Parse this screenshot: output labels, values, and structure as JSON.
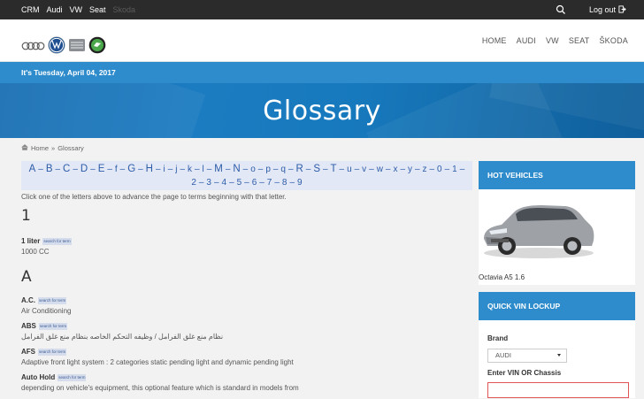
{
  "topbar": {
    "links": [
      "CRM",
      "Audi",
      "VW",
      "Seat"
    ],
    "faded_link": "Skoda",
    "logout_label": "Log out",
    "icons": [
      "search-icon",
      "logout-icon"
    ]
  },
  "header": {
    "logos": [
      "audi-logo",
      "vw-logo",
      "seat-logo",
      "skoda-logo"
    ],
    "nav": [
      "HOME",
      "AUDI",
      "VW",
      "SEAT",
      "ŠKODA"
    ]
  },
  "date_text": "It's Tuesday, April 04, 2017",
  "hero_title": "Glossary",
  "breadcrumb": {
    "home": "Home",
    "separator": "»",
    "current": "Glossary"
  },
  "glossary": {
    "alphabet_line1": [
      "A",
      "B",
      "C",
      "D",
      "E",
      "f",
      "G",
      "H",
      "i",
      "j",
      "k",
      "l",
      "M",
      "N",
      "o",
      "p",
      "q",
      "R",
      "S",
      "T",
      "u",
      "v",
      "w",
      "x",
      "y",
      "z",
      "0",
      "1"
    ],
    "alphabet_line2": [
      "2",
      "3",
      "4",
      "5",
      "6",
      "7",
      "8",
      "9"
    ],
    "separator": "–",
    "intro": "Click one of the letters above to advance the page to terms beginning with that letter.",
    "sections": [
      {
        "letter": "1",
        "terms": [
          {
            "name": "1 liter",
            "tag": "search for term",
            "definition": "1000 CC"
          }
        ]
      },
      {
        "letter": "A",
        "terms": [
          {
            "name": "A.C.",
            "tag": "search for term",
            "definition": "Air Conditioning"
          },
          {
            "name": "ABS",
            "tag": "search for term",
            "definition": "نظام منع غلق الفرامل / وظيفه التحكم الخاصه بنظام منع غلق الفرامل"
          },
          {
            "name": "AFS",
            "tag": "search for term",
            "definition": "Adaptive front light system : 2 categories static pending light and dynamic pending light"
          },
          {
            "name": "Auto Hold",
            "tag": "search for term",
            "definition": "depending on vehicle's equipment, this optional feature which is standard in models from"
          }
        ]
      }
    ]
  },
  "sidebar": {
    "hot_title": "HOT VEHICLES",
    "hot_caption": "Octavia A5 1.6",
    "vin_title": "QUICK VIN LOCKUP",
    "brand_label": "Brand",
    "brand_value": "AUDI",
    "vin_label": "Enter VIN OR Chassis",
    "vin_value": ""
  },
  "colors": {
    "accent": "#2e8ccc",
    "topbar": "#2b2b2b",
    "link": "#2c5ca8",
    "tag_bg": "#d5dcec",
    "vin_border": "#e05555"
  }
}
